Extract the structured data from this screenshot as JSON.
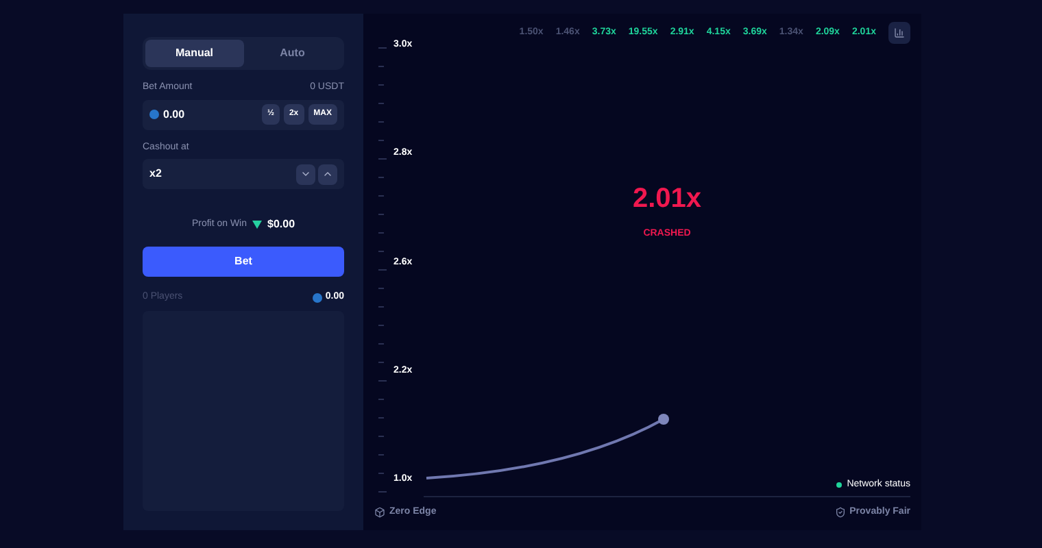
{
  "mode_tabs": [
    {
      "label": "Manual",
      "selected": true
    },
    {
      "label": "Auto",
      "selected": false
    }
  ],
  "bet_amount": {
    "label": "Bet Amount",
    "balance": "0 USDT",
    "value": "0.00",
    "buttons": [
      "½",
      "2x",
      "MAX"
    ]
  },
  "cashout": {
    "label": "Cashout at",
    "value": "x2"
  },
  "profit": {
    "label": "Profit on Win",
    "value": "$0.00"
  },
  "bet_button": "Bet",
  "players": {
    "count": "0 Players",
    "total": "0.00"
  },
  "history": [
    {
      "value": "1.50x",
      "color": "#4b5273"
    },
    {
      "value": "1.46x",
      "color": "#4b5273"
    },
    {
      "value": "3.73x",
      "color": "#1fd39a"
    },
    {
      "value": "19.55x",
      "color": "#1fd39a"
    },
    {
      "value": "2.91x",
      "color": "#1fd39a"
    },
    {
      "value": "4.15x",
      "color": "#1fd39a"
    },
    {
      "value": "3.69x",
      "color": "#1fd39a"
    },
    {
      "value": "1.34x",
      "color": "#4b5273"
    },
    {
      "value": "2.09x",
      "color": "#1fd39a"
    },
    {
      "value": "2.01x",
      "color": "#1fd39a"
    }
  ],
  "axis_labels": [
    "3.0x",
    "2.8x",
    "2.6x",
    "2.2x",
    "1.0x"
  ],
  "result": {
    "multiplier": "2.01x",
    "status": "CRASHED"
  },
  "network_status": "Network status",
  "footer": {
    "left": "Zero Edge",
    "right": "Provably Fair"
  }
}
